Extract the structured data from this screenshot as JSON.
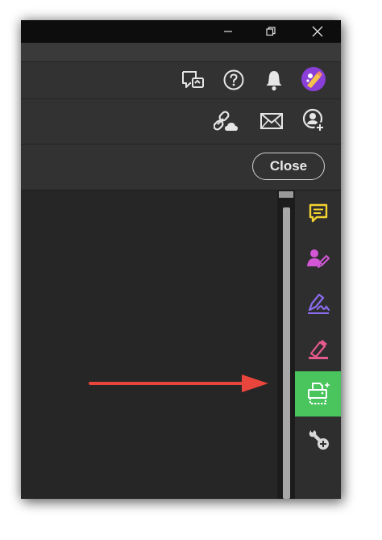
{
  "window": {
    "controls": [
      "minimize",
      "restore",
      "close"
    ]
  },
  "toolbar_top": {
    "icons": [
      "share-review-icon",
      "help-icon",
      "notifications-icon",
      "avatar"
    ]
  },
  "toolbar_share": {
    "icons": [
      "share-link-icon",
      "email-icon",
      "add-user-icon"
    ]
  },
  "toolbar_mode": {
    "close_label": "Close"
  },
  "right_rail": {
    "tools": [
      {
        "name": "comment-tool",
        "color": "#f2d230"
      },
      {
        "name": "request-signatures-tool",
        "color": "#d256d6"
      },
      {
        "name": "fill-sign-tool",
        "color": "#8c6cf0"
      },
      {
        "name": "highlight-tool",
        "color": "#e45a8c"
      },
      {
        "name": "scan-ocr-tool",
        "color": "#4ac55d",
        "active": true
      },
      {
        "name": "more-tools",
        "color": "#d8d8d8"
      }
    ]
  },
  "annotation": {
    "arrow_color": "#e8453c"
  }
}
